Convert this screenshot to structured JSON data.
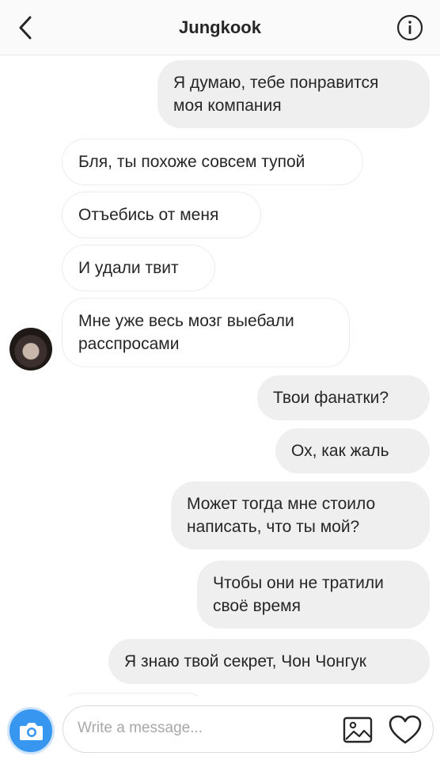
{
  "header": {
    "back_icon": "chevron-left-icon",
    "title": "Jungkook",
    "info_icon": "info-circle-icon"
  },
  "messages": [
    {
      "from": "me",
      "lines": [
        "Я думаю, тебе понравится",
        "моя компания"
      ]
    },
    {
      "from": "them",
      "lines": [
        "Бля, ты похоже совсем тупой"
      ]
    },
    {
      "from": "them",
      "lines": [
        "Отъебись от меня"
      ]
    },
    {
      "from": "them",
      "lines": [
        "И удали твит"
      ]
    },
    {
      "from": "them",
      "lines": [
        "Мне уже весь мозг выебали",
        "расспросами"
      ]
    },
    {
      "from": "me",
      "lines": [
        "Твои фанатки?"
      ]
    },
    {
      "from": "me",
      "lines": [
        "Ох, как жаль"
      ]
    },
    {
      "from": "me",
      "lines": [
        "Может тогда мне стоило",
        "написать, что ты мой?"
      ]
    },
    {
      "from": "me",
      "lines": [
        "Чтобы они не тратили",
        "своё время"
      ]
    },
    {
      "from": "me",
      "lines": [
        "Я знаю твой секрет, Чон Чонгук"
      ]
    }
  ],
  "composer": {
    "camera_icon": "camera-icon",
    "placeholder": "Write a message...",
    "gallery_icon": "image-gallery-icon",
    "heart_icon": "heart-icon"
  },
  "colors": {
    "sent_bubble": "#efefef",
    "received_border": "#ececec",
    "camera_accent": "#3797f0",
    "text": "#262626"
  }
}
